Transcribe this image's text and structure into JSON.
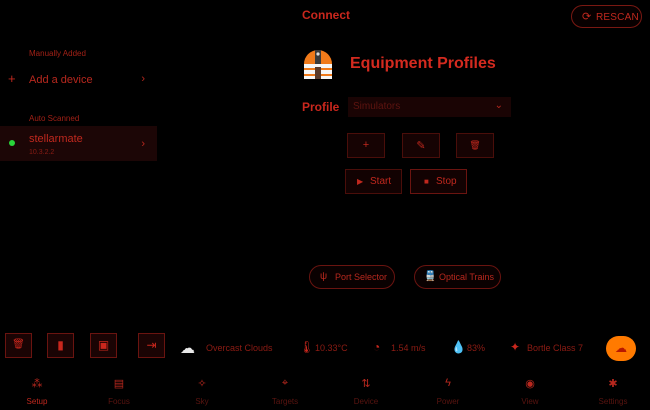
{
  "left": {
    "manual_label": "Manually Added",
    "add_device_icon": "+",
    "add_device_label": "Add a device",
    "chevron": "›",
    "auto_label": "Auto Scanned",
    "device": {
      "name": "stellarmate",
      "ip": "10.3.2.2",
      "status_color": "#29d63a"
    }
  },
  "connect": {
    "title": "Connect",
    "rescan_icon": "⟳",
    "rescan_label": "RESCAN",
    "profiles_title": "Equipment Profiles",
    "profile_label": "Profile",
    "profile_value": "Simulators",
    "dropdown_icon": "⌄",
    "add_icon": "+",
    "edit_icon": "✎",
    "delete_icon": "🗑",
    "start_icon": "▶",
    "start_label": "Start",
    "stop_icon": "■",
    "stop_label": "Stop",
    "port_selector_icon": "ψ",
    "port_selector_label": "Port Selector",
    "optical_trains_icon": "🚆",
    "optical_trains_label": "Optical Trains"
  },
  "toolbar": {
    "trash_icon": "🗑",
    "sd_icon": "▮",
    "cpu_icon": "▣",
    "exit_icon": "⇥"
  },
  "status": {
    "weather_icon": "☁",
    "weather": "Overcast Clouds",
    "temp_icon": "🌡",
    "temperature": "10.33°C",
    "wind_icon": "◔",
    "wind": "1.54 m/s",
    "humidity_icon": "💧",
    "humidity": "83%",
    "bortle_icon": "✦",
    "bortle": "Bortle Class 7",
    "cloud_button_icon": "☁"
  },
  "nav": [
    {
      "icon": "⁂",
      "label": "Setup"
    },
    {
      "icon": "▤",
      "label": "Focus"
    },
    {
      "icon": "✧",
      "label": "Sky"
    },
    {
      "icon": "⌖",
      "label": "Targets"
    },
    {
      "icon": "⇅",
      "label": "Device"
    },
    {
      "icon": "ϟ",
      "label": "Power"
    },
    {
      "icon": "◉",
      "label": "View"
    },
    {
      "icon": "✱",
      "label": "Settings"
    }
  ],
  "colors": {
    "accent": "#c9271d",
    "background": "#000000",
    "cloud_button": "#ff7a00",
    "online": "#29d63a"
  }
}
